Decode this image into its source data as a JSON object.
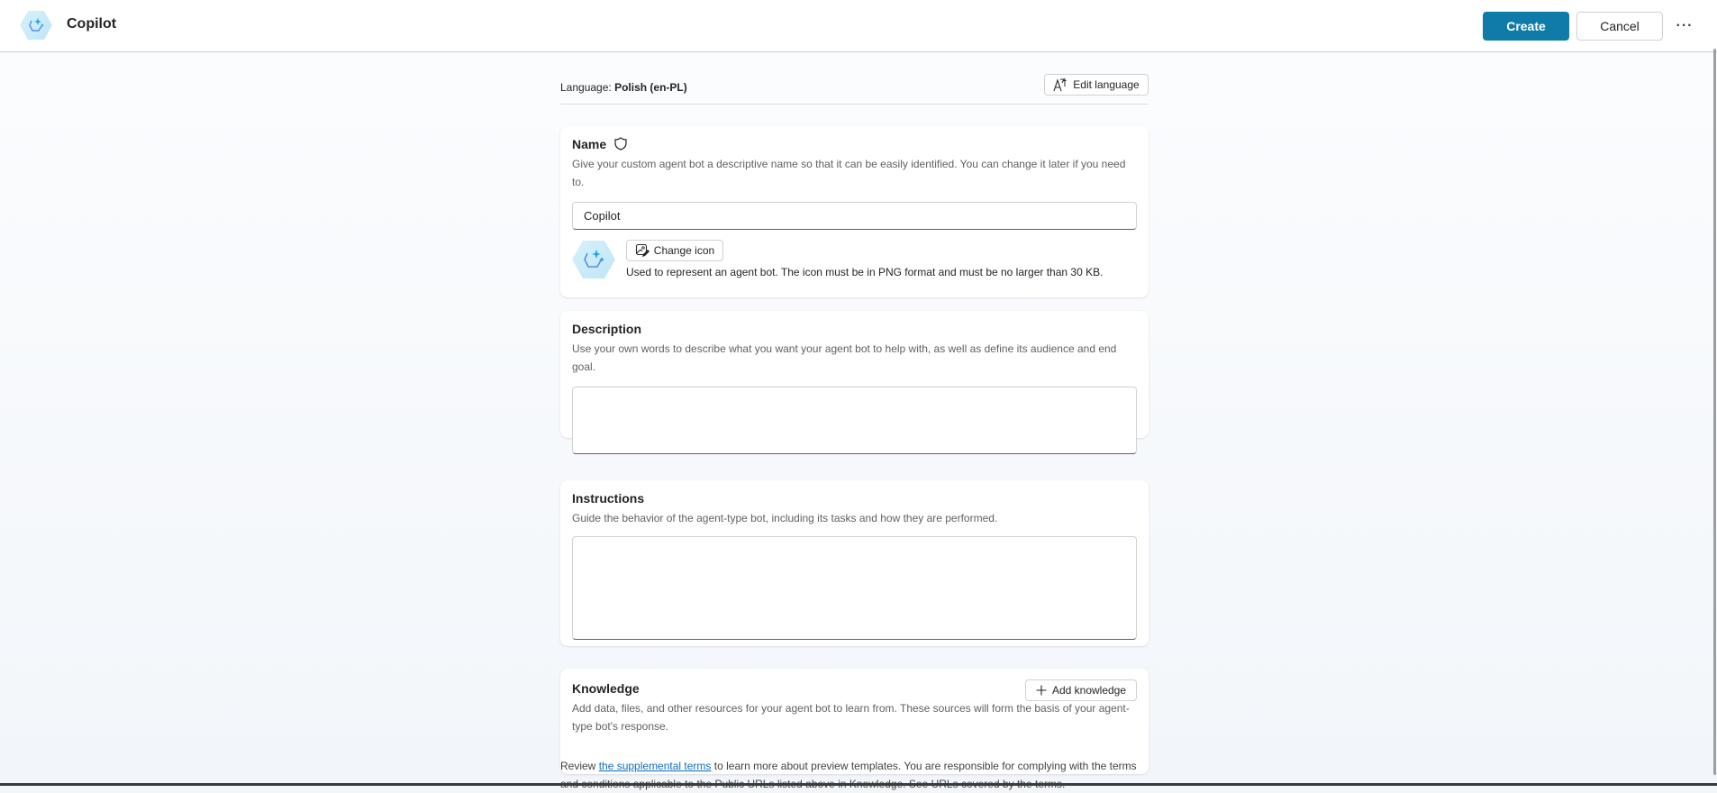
{
  "header": {
    "app_icon": "copilot-agent-icon",
    "title": "Copilot",
    "create_label": "Create",
    "cancel_label": "Cancel",
    "more_label": "···",
    "more_icon": "more-horizontal-icon"
  },
  "language": {
    "prefix": "Language: ",
    "value": "Polish (en-PL)",
    "edit_label": "Edit language",
    "edit_icon": "translate-icon"
  },
  "name_section": {
    "title": "Name",
    "title_icon": "shield-icon",
    "description": "Give your custom agent bot a descriptive name so that it can be easily identified. You can change it later if you need to.",
    "input_value": "Copilot",
    "change_icon_label": "Change icon",
    "change_icon_icon": "image-edit-icon",
    "icon_help": "Used to represent an agent bot. The icon must be in PNG format and must be no larger than 30 KB."
  },
  "description_section": {
    "title": "Description",
    "description": "Use your own words to describe what you want your agent bot to help with, as well as define its audience and end goal.",
    "input_value": ""
  },
  "instructions_section": {
    "title": "Instructions",
    "description": "Guide the behavior of the agent-type bot, including its tasks and how they are performed.",
    "input_value": ""
  },
  "knowledge_section": {
    "title": "Knowledge",
    "description": "Add data, files, and other resources for your agent bot to learn from. These sources will form the basis of your agent-type bot's response.",
    "add_label": "Add knowledge",
    "add_icon": "plus-icon"
  },
  "footer": {
    "prefix": "Review ",
    "link_text": "the supplemental terms",
    "suffix": " to learn more about preview templates. You are responsible for complying with the terms and conditions applicable to the Public URLs listed above in Knowledge. See URLs covered by the terms."
  },
  "colors": {
    "primary": "#0f7ba8",
    "link": "#0f6cbd"
  }
}
